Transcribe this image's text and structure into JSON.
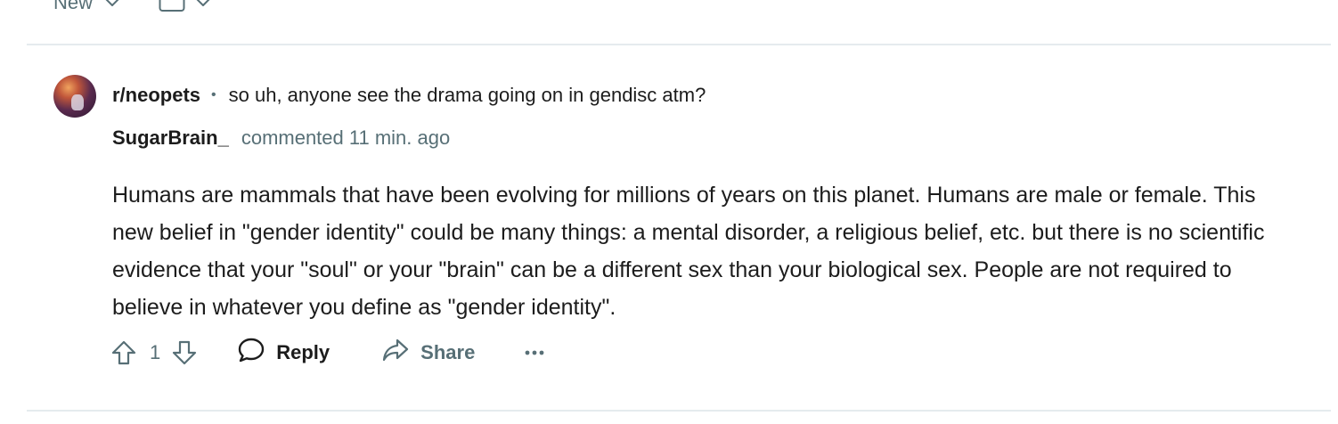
{
  "sort": {
    "label": "New"
  },
  "comment": {
    "subreddit": "r/neopets",
    "separator": "•",
    "post_title": "so uh, anyone see the drama going on in gendisc atm?",
    "author": "SugarBrain_",
    "meta": "commented 11 min. ago",
    "body": "Humans are mammals that have been evolving for millions of years on this planet. Humans are male or female. This new belief in \"gender identity\" could be many things: a mental disorder, a religious belief, etc. but there is no scientific evidence that your \"soul\" or your \"brain\" can be a different sex than your biological sex. People are not required to believe in whatever you define as \"gender identity\".",
    "score": "1",
    "reply_label": "Reply",
    "share_label": "Share"
  },
  "icons": {
    "sort_chevron": "chevron-down-icon",
    "view": "card-view-icon",
    "upvote": "upvote-arrow-icon",
    "downvote": "downvote-arrow-icon",
    "reply": "speech-bubble-icon",
    "share": "share-arrow-icon",
    "more": "ellipsis-icon"
  },
  "colors": {
    "text": "#1c1c1c",
    "muted": "#576f76",
    "divider": "#e5ebee"
  }
}
